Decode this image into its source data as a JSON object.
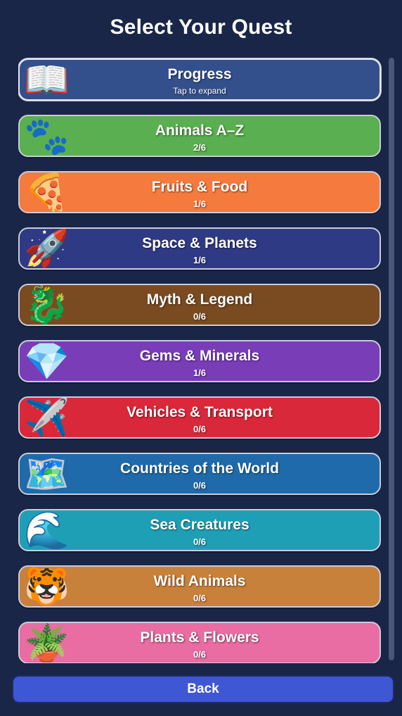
{
  "header": {
    "title": "Select Your Quest"
  },
  "progress_card": {
    "label": "Progress",
    "hint": "Tap to expand",
    "icon": "open-book-icon",
    "emoji": "📖",
    "color": "#34508c"
  },
  "quests": [
    {
      "id": "animals-az",
      "label": "Animals A–Z",
      "progress": "2/6",
      "icon": "paw-prints-icon",
      "emoji": "🐾",
      "color": "#5aaf50"
    },
    {
      "id": "fruits-food",
      "label": "Fruits & Food",
      "progress": "1/6",
      "icon": "pizza-icon",
      "emoji": "🍕",
      "color": "#f57a3d"
    },
    {
      "id": "space-planets",
      "label": "Space & Planets",
      "progress": "1/6",
      "icon": "rocket-icon",
      "emoji": "🚀",
      "color": "#2f3a85"
    },
    {
      "id": "myth-legend",
      "label": "Myth & Legend",
      "progress": "0/6",
      "icon": "dragon-icon",
      "emoji": "🐉",
      "color": "#7a4a20"
    },
    {
      "id": "gems-minerals",
      "label": "Gems & Minerals",
      "progress": "1/6",
      "icon": "gem-icon",
      "emoji": "💎",
      "color": "#7a3db8"
    },
    {
      "id": "vehicles-transport",
      "label": "Vehicles & Transport",
      "progress": "0/6",
      "icon": "airplane-icon",
      "emoji": "✈️",
      "color": "#d9283a"
    },
    {
      "id": "countries-world",
      "label": "Countries of the World",
      "progress": "0/6",
      "icon": "world-map-icon",
      "emoji": "🗺️",
      "color": "#1f6aaa"
    },
    {
      "id": "sea-creatures",
      "label": "Sea Creatures",
      "progress": "0/6",
      "icon": "wave-icon",
      "emoji": "🌊",
      "color": "#1e9fb6"
    },
    {
      "id": "wild-animals",
      "label": "Wild Animals",
      "progress": "0/6",
      "icon": "tiger-face-icon",
      "emoji": "🐯",
      "color": "#c8813a"
    },
    {
      "id": "plants-flowers",
      "label": "Plants & Flowers",
      "progress": "0/6",
      "icon": "potted-plant-icon",
      "emoji": "🪴",
      "color": "#e96ca3"
    }
  ],
  "footer": {
    "back_label": "Back"
  }
}
